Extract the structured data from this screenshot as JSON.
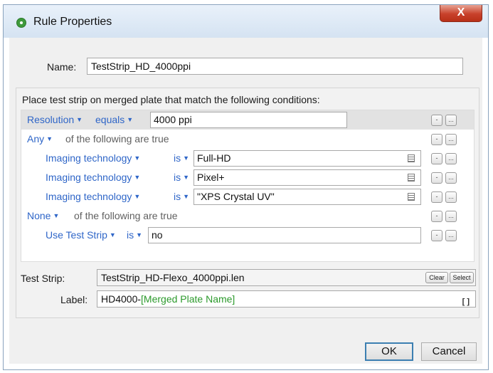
{
  "window": {
    "title": "Rule Properties",
    "close_label": "X"
  },
  "name": {
    "label": "Name:",
    "value": "TestStrip_HD_4000ppi"
  },
  "conditions": {
    "heading": "Place test strip on merged plate that match the following conditions:",
    "remove_label": "-",
    "more_label": "...",
    "rows": [
      {
        "field": "Resolution",
        "operator": "equals",
        "value": "4000 ppi"
      },
      {
        "quantifier": "Any",
        "suffix": "of the following are true"
      },
      {
        "field": "Imaging technology",
        "operator": "is",
        "value": "Full-HD"
      },
      {
        "field": "Imaging technology",
        "operator": "is",
        "value": "Pixel+"
      },
      {
        "field": "Imaging technology",
        "operator": "is",
        "value": "\"XPS Crystal UV\""
      },
      {
        "quantifier": "None",
        "suffix": "of the following are true"
      },
      {
        "field": "Use Test Strip",
        "operator": "is",
        "value": "no"
      }
    ]
  },
  "test_strip": {
    "label": "Test Strip:",
    "value": "TestStrip_HD-Flexo_4000ppi.len",
    "clear_label": "Clear",
    "select_label": "Select"
  },
  "label_field": {
    "label": "Label:",
    "prefix": "HD4000-",
    "variable": "[Merged Plate Name]"
  },
  "buttons": {
    "ok": "OK",
    "cancel": "Cancel"
  },
  "colors": {
    "accent_blue": "#2f66c8",
    "variable_green": "#2c9a2c",
    "close_red": "#c8412b"
  },
  "icons": [
    "settings-icon",
    "close-icon",
    "list-icon",
    "bracket-icon"
  ]
}
